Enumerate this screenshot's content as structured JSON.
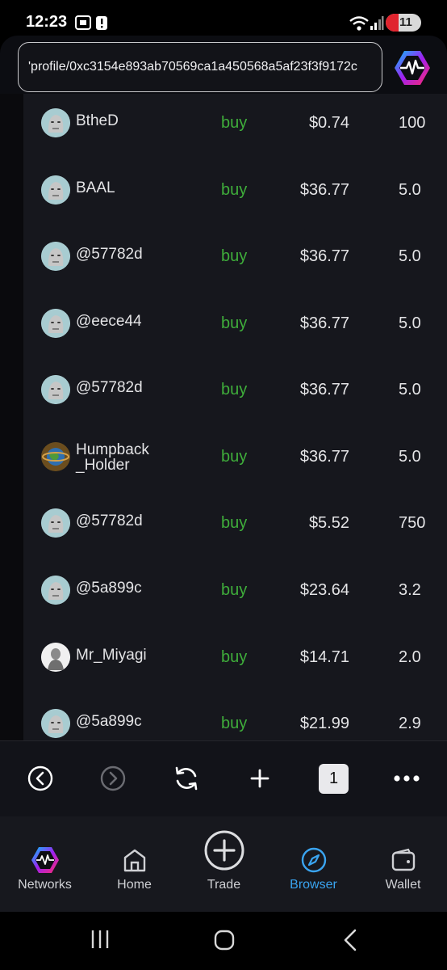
{
  "status_bar": {
    "time": "12:23",
    "battery": "11"
  },
  "browser": {
    "url": "'profile/0xc3154e893ab70569ca1a450568a5af23f3f9172c",
    "tab_count": "1"
  },
  "trades": [
    {
      "user": "BtheD",
      "side": "buy",
      "price": "$0.74",
      "amount": "100",
      "avatar": "npc-face"
    },
    {
      "user": "BAAL",
      "side": "buy",
      "price": "$36.77",
      "amount": "5.0",
      "avatar": "npc-face"
    },
    {
      "user": "@57782d",
      "side": "buy",
      "price": "$36.77",
      "amount": "5.0",
      "avatar": "npc-face"
    },
    {
      "user": "@eece44",
      "side": "buy",
      "price": "$36.77",
      "amount": "5.0",
      "avatar": "npc-face"
    },
    {
      "user": "@57782d",
      "side": "buy",
      "price": "$36.77",
      "amount": "5.0",
      "avatar": "npc-face"
    },
    {
      "user": "Humpback _Holder",
      "side": "buy",
      "price": "$36.77",
      "amount": "5.0",
      "avatar": "earth-photo"
    },
    {
      "user": "@57782d",
      "side": "buy",
      "price": "$5.52",
      "amount": "750",
      "avatar": "npc-face"
    },
    {
      "user": "@5a899c",
      "side": "buy",
      "price": "$23.64",
      "amount": "3.2",
      "avatar": "npc-face"
    },
    {
      "user": "Mr_Miyagi",
      "side": "buy",
      "price": "$14.71",
      "amount": "2.0",
      "avatar": "statue-photo"
    },
    {
      "user": "@5a899c",
      "side": "buy",
      "price": "$21.99",
      "amount": "2.9",
      "avatar": "npc-face"
    }
  ],
  "toolbar": {
    "icons": [
      "back-icon",
      "forward-icon",
      "reload-icon",
      "new-tab-icon",
      "tab-count",
      "more-icon"
    ]
  },
  "tabbar": {
    "tabs": [
      {
        "label": "Networks",
        "icon": "pulse-logo-icon"
      },
      {
        "label": "Home",
        "icon": "home-icon"
      },
      {
        "label": "Trade",
        "icon": "plus-circle-icon"
      },
      {
        "label": "Browser",
        "icon": "compass-icon",
        "active": true
      },
      {
        "label": "Wallet",
        "icon": "wallet-icon"
      }
    ]
  },
  "colors": {
    "buy": "#3fae3b",
    "active_tab": "#3aa4f0",
    "panel": "#16171d"
  }
}
